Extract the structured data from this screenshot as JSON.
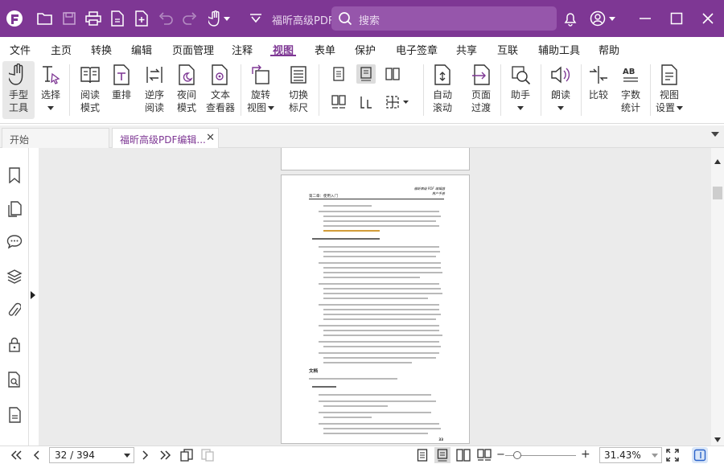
{
  "titlebar": {
    "document_title": "福昕高级PDF...",
    "search_placeholder": "搜索"
  },
  "menu": [
    "文件",
    "主页",
    "转换",
    "编辑",
    "页面管理",
    "注释",
    "视图",
    "表单",
    "保护",
    "电子签章",
    "共享",
    "互联",
    "辅助工具",
    "帮助"
  ],
  "menu_active": "视图",
  "ribbon": {
    "hand": [
      "手型",
      "工具"
    ],
    "select": [
      "选择",
      ""
    ],
    "reading_mode": [
      "阅读",
      "模式"
    ],
    "reflow": [
      "重排",
      ""
    ],
    "reverse_reading": [
      "逆序",
      "阅读"
    ],
    "night_mode": [
      "夜间",
      "模式"
    ],
    "text_viewer": [
      "文本",
      "查看器"
    ],
    "rotate_view": [
      "旋转",
      "视图"
    ],
    "toggle_ruler": [
      "切换",
      "标尺"
    ],
    "auto_scroll": [
      "自动",
      "滚动"
    ],
    "page_transition": [
      "页面",
      "过渡"
    ],
    "assistant": [
      "助手",
      ""
    ],
    "read_aloud": [
      "朗读",
      ""
    ],
    "compare": [
      "比较",
      ""
    ],
    "word_count": [
      "字数",
      "统计"
    ],
    "view_settings": [
      "视图",
      "设置"
    ]
  },
  "tabs": {
    "home": "开始",
    "document": "福昕高级PDF编辑..."
  },
  "page_content": {
    "header_left": "第二章：使用入门",
    "header_right": [
      "福昕高级 PDF 编辑器",
      "用户手册"
    ],
    "section_title": "文档",
    "page_number": "33"
  },
  "statusbar": {
    "page_indicator": "32 / 394",
    "zoom": "31.43%"
  },
  "colors": {
    "brand": "#7e3794",
    "search_bg": "#9656ab"
  }
}
